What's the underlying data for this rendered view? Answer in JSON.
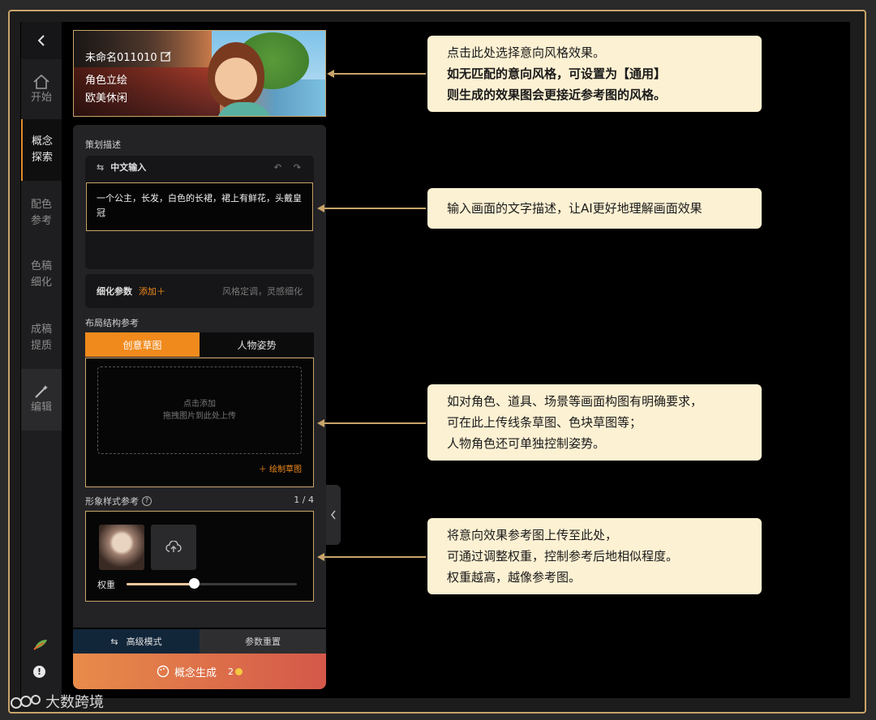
{
  "nav": {
    "items": [
      {
        "label": "开始",
        "icon": "home-icon"
      },
      {
        "label": "概念探索",
        "icon": "none"
      },
      {
        "label": "配色参考",
        "icon": "none"
      },
      {
        "label": "色稿细化",
        "icon": "none"
      },
      {
        "label": "成稿提质",
        "icon": "none"
      },
      {
        "label": "编辑",
        "icon": "magic-wand-icon"
      }
    ],
    "active_index": 1
  },
  "project": {
    "name": "未命名011010",
    "category": "角色立绘",
    "style": "欧美休闲"
  },
  "description": {
    "section_title": "策划描述",
    "input_mode": "中文输入",
    "text": "一个公主，长发，白色的长裙，裙上有鲜花，头戴皇冠"
  },
  "params": {
    "label": "细化参数",
    "add_label": "添加＋",
    "hint": "风格定调，灵感细化"
  },
  "layout_ref": {
    "section_title": "布局结构参考",
    "tabs": [
      "创意草图",
      "人物姿势"
    ],
    "active_tab": 0,
    "drop_line1": "点击添加",
    "drop_line2": "拖拽图片到此处上传",
    "draw_sketch": "＋ 绘制草图"
  },
  "style_ref": {
    "section_title": "形象样式参考",
    "count": "1 / 4",
    "weight_label": "权重",
    "weight_value": 0.4
  },
  "footer": {
    "advanced_mode": "高级模式",
    "reset": "参数重置",
    "generate": "概念生成",
    "cost": "2"
  },
  "callouts": {
    "c1_line1": "点击此处选择意向风格效果。",
    "c1_line2": "如无匹配的意向风格，可设置为【通用】",
    "c1_line3": "则生成的效果图会更接近参考图的风格。",
    "c2_line1": "输入画面的文字描述，让AI更好地理解画面效果",
    "c3_line1": "如对角色、道具、场景等画面构图有明确要求，",
    "c3_line2": "可在此上传线条草图、色块草图等；",
    "c3_line3": "人物角色还可单独控制姿势。",
    "c4_line1": "将意向效果参考图上传至此处，",
    "c4_line2": "可通过调整权重，控制参考后地相似程度。",
    "c4_line3": "权重越高，越像参考图。"
  },
  "watermark": "大数跨境",
  "colors": {
    "accent": "#f08a1c",
    "frame": "#c9a46a",
    "callout_bg": "#fdf1d3"
  }
}
